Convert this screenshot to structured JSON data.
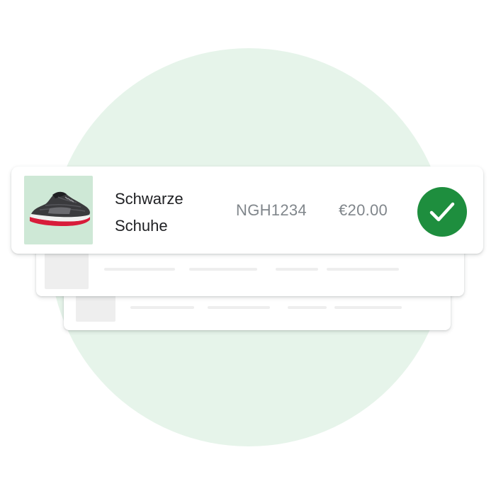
{
  "product": {
    "name_line1": "Schwarze",
    "name_line2": "Schuhe",
    "sku": "NGH1234",
    "price": "€20.00",
    "image_icon": "black-running-shoe",
    "status_icon": "check-icon"
  },
  "colors": {
    "background_circle": "#e6f4ea",
    "thumbnail_bg": "#cee8d6",
    "check_badge": "#1e8e3e",
    "primary_text": "#202124",
    "secondary_text": "#80868b",
    "placeholder": "#eeeeee"
  }
}
